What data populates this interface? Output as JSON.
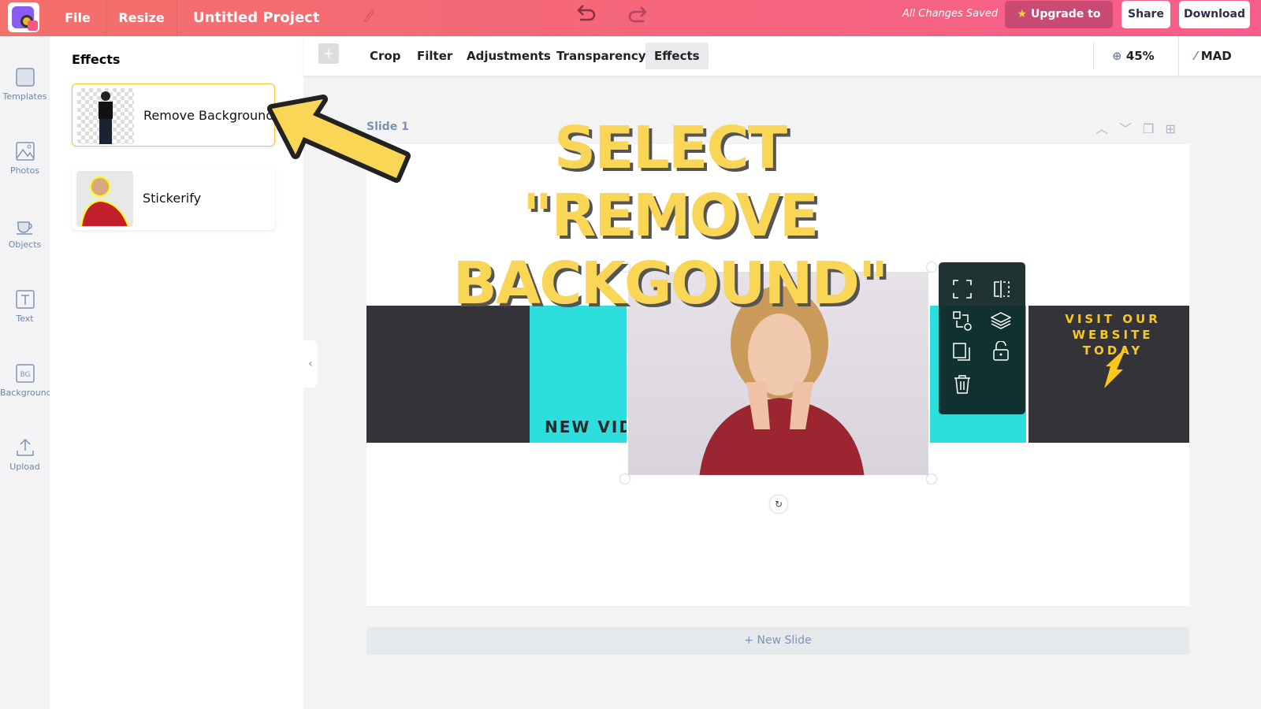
{
  "topbar": {
    "file": "File",
    "resize": "Resize",
    "title": "Untitled Project",
    "status": "All Changes Saved",
    "upgrade": "Upgrade to pro",
    "share": "Share",
    "download": "Download"
  },
  "sidebar": {
    "items": [
      {
        "label": "Templates",
        "icon": "templates-icon"
      },
      {
        "label": "Photos",
        "icon": "photos-icon"
      },
      {
        "label": "Objects",
        "icon": "objects-icon"
      },
      {
        "label": "Text",
        "icon": "text-icon"
      },
      {
        "label": "Background",
        "icon": "background-icon",
        "glyph": "BG"
      },
      {
        "label": "Upload",
        "icon": "upload-icon"
      }
    ]
  },
  "panel": {
    "title": "Effects",
    "cards": [
      {
        "label": "Remove Background",
        "selected": true
      },
      {
        "label": "Stickerify",
        "selected": false
      }
    ]
  },
  "toolbar": {
    "tabs": [
      "Crop",
      "Filter",
      "Adjustments",
      "Transparency",
      "Effects"
    ],
    "active": "Effects",
    "zoom": "45%",
    "magic": "MAD"
  },
  "slide": {
    "label": "Slide 1",
    "new_video": "NEW VIDE",
    "visit": "VISIT OUR WEBSITE TODAY",
    "new_slide": "+ New Slide"
  },
  "annotation": {
    "headline": "SELECT \"REMOVE BACKGOUND\""
  },
  "colors": {
    "accent": "#f75d8c",
    "cyan": "#2ddfdc",
    "dark": "#343338",
    "yellow": "#f9d656"
  }
}
